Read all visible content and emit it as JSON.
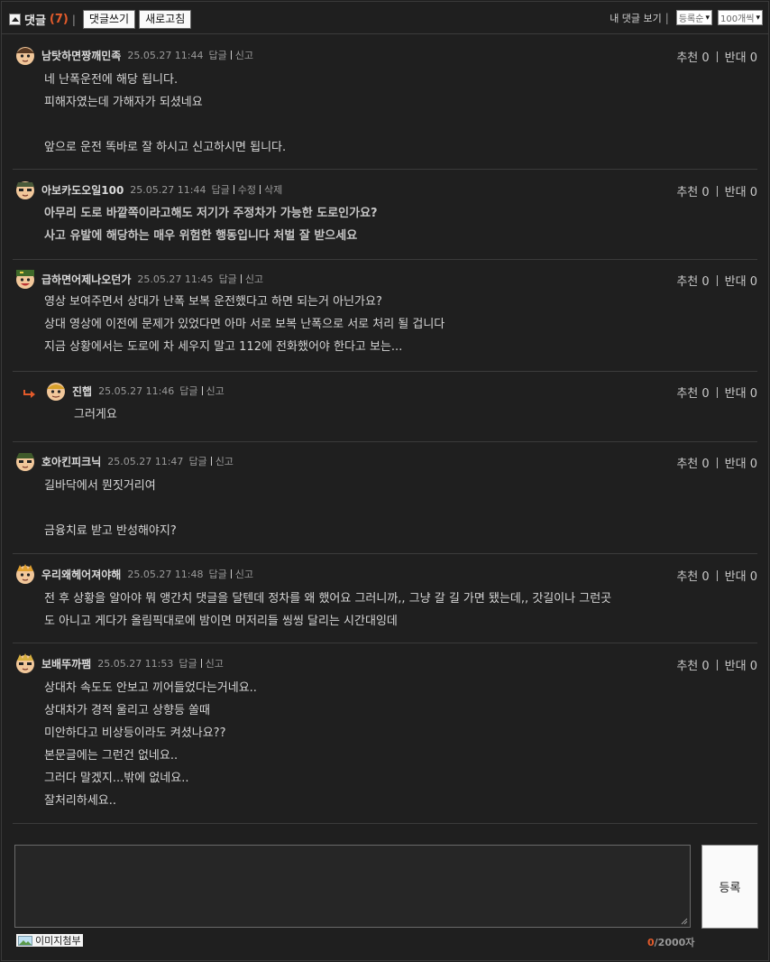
{
  "header": {
    "title": "댓글",
    "count": "(7)",
    "separator": "|",
    "write_button": "댓글쓰기",
    "refresh_button": "새로고침",
    "my_comments": "내 댓글 보기",
    "right_separator": "|",
    "sort_select": "등록순",
    "per_page_select": "100개씩"
  },
  "vote_labels": {
    "up": "추천",
    "down": "반대"
  },
  "comments": [
    {
      "nick": "남탓하면짱깨민족",
      "date": "25.05.27 11:44",
      "actions": [
        "답글",
        "신고"
      ],
      "up": "0",
      "down": "0",
      "lines": [
        "네 난폭운전에 해당 됩니다.",
        "피해자였는데 가해자가 되셨네요",
        "",
        "앞으로 운전 똑바로 잘 하시고 신고하시면 됩니다."
      ]
    },
    {
      "nick": "아보카도오일100",
      "date": "25.05.27 11:44",
      "actions": [
        "답글",
        "수정",
        "삭제"
      ],
      "up": "0",
      "down": "0",
      "lines": [
        "아무리 도로 바깥쪽이라고해도 저기가 주정차가 가능한 도로인가요?",
        "사고 유발에 해당하는 매우 위험한 행동입니다 처벌 잘 받으세요"
      ]
    },
    {
      "nick": "급하면어제나오던가",
      "date": "25.05.27 11:45",
      "actions": [
        "답글",
        "신고"
      ],
      "up": "0",
      "down": "0",
      "lines": [
        "영상 보여주면서 상대가 난폭 보복 운전했다고 하면 되는거 아닌가요?",
        "상대 영상에 이전에 문제가 있었다면 아마 서로 보복 난폭으로 서로 처리 될 겁니다",
        "지금 상황에서는 도로에 차 세우지 말고 112에 전화했어야 한다고 보는..."
      ]
    },
    {
      "nick": "진햅",
      "date": "25.05.27 11:46",
      "actions": [
        "답글",
        "신고"
      ],
      "up": "0",
      "down": "0",
      "lines": [
        "그러게요"
      ]
    },
    {
      "nick": "호아킨피크닉",
      "date": "25.05.27 11:47",
      "actions": [
        "답글",
        "신고"
      ],
      "up": "0",
      "down": "0",
      "lines": [
        "길바닥에서 뭔짓거리여",
        "",
        "금융치료 받고 반성해야지?"
      ]
    },
    {
      "nick": "우리왜헤어져야해",
      "date": "25.05.27 11:48",
      "actions": [
        "답글",
        "신고"
      ],
      "up": "0",
      "down": "0",
      "lines": [
        "전 후 상황을 알아야 뭐 앵간치 댓글을 달텐데 정차를 왜 했어요 그러니까,, 그냥 갈 길 가면 됐는데,, 갓길이나 그런곳",
        "도 아니고 게다가 올림픽대로에 밤이면 머저리들 씽씽 달리는 시간대잉데"
      ]
    },
    {
      "nick": "보배뚜까팸",
      "date": "25.05.27 11:53",
      "actions": [
        "답글",
        "신고"
      ],
      "up": "0",
      "down": "0",
      "lines": [
        "상대차 속도도 안보고 끼어들었다는거네요..",
        "상대차가 경적 울리고 상향등 쏠때",
        "미안하다고 비상등이라도 켜셨나요??",
        "본문글에는 그런건 없네요..",
        "그러다 말겠지...밖에 없네요..",
        "잘처리하세요.."
      ]
    }
  ],
  "write": {
    "submit_label": "등록",
    "attach_label": "이미지첨부",
    "counter_current": "0",
    "counter_max": "/2000자"
  }
}
